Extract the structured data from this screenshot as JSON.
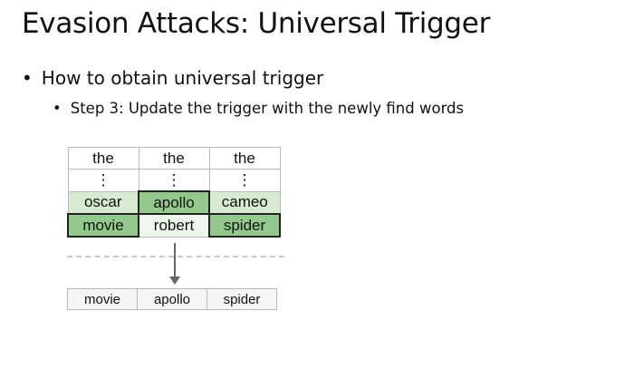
{
  "slide": {
    "title": "Evasion Attacks: Universal Trigger",
    "bullet_char": "•",
    "bullet1": "How to obtain universal trigger",
    "bullet2": "Step 3: Update the trigger with the newly find words"
  },
  "figure": {
    "rows": [
      [
        "the",
        "the",
        "the"
      ],
      [
        "⋮",
        "⋮",
        "⋮"
      ],
      [
        "oscar",
        "apollo",
        "cameo"
      ],
      [
        "movie",
        "robert",
        "spider"
      ]
    ],
    "result": [
      "movie",
      "apollo",
      "spider"
    ],
    "colors": {
      "light_green": "#d6ebcf",
      "medium_green": "#93c98c",
      "pale_green": "#eef7ec",
      "selected_border": "#222222"
    }
  }
}
